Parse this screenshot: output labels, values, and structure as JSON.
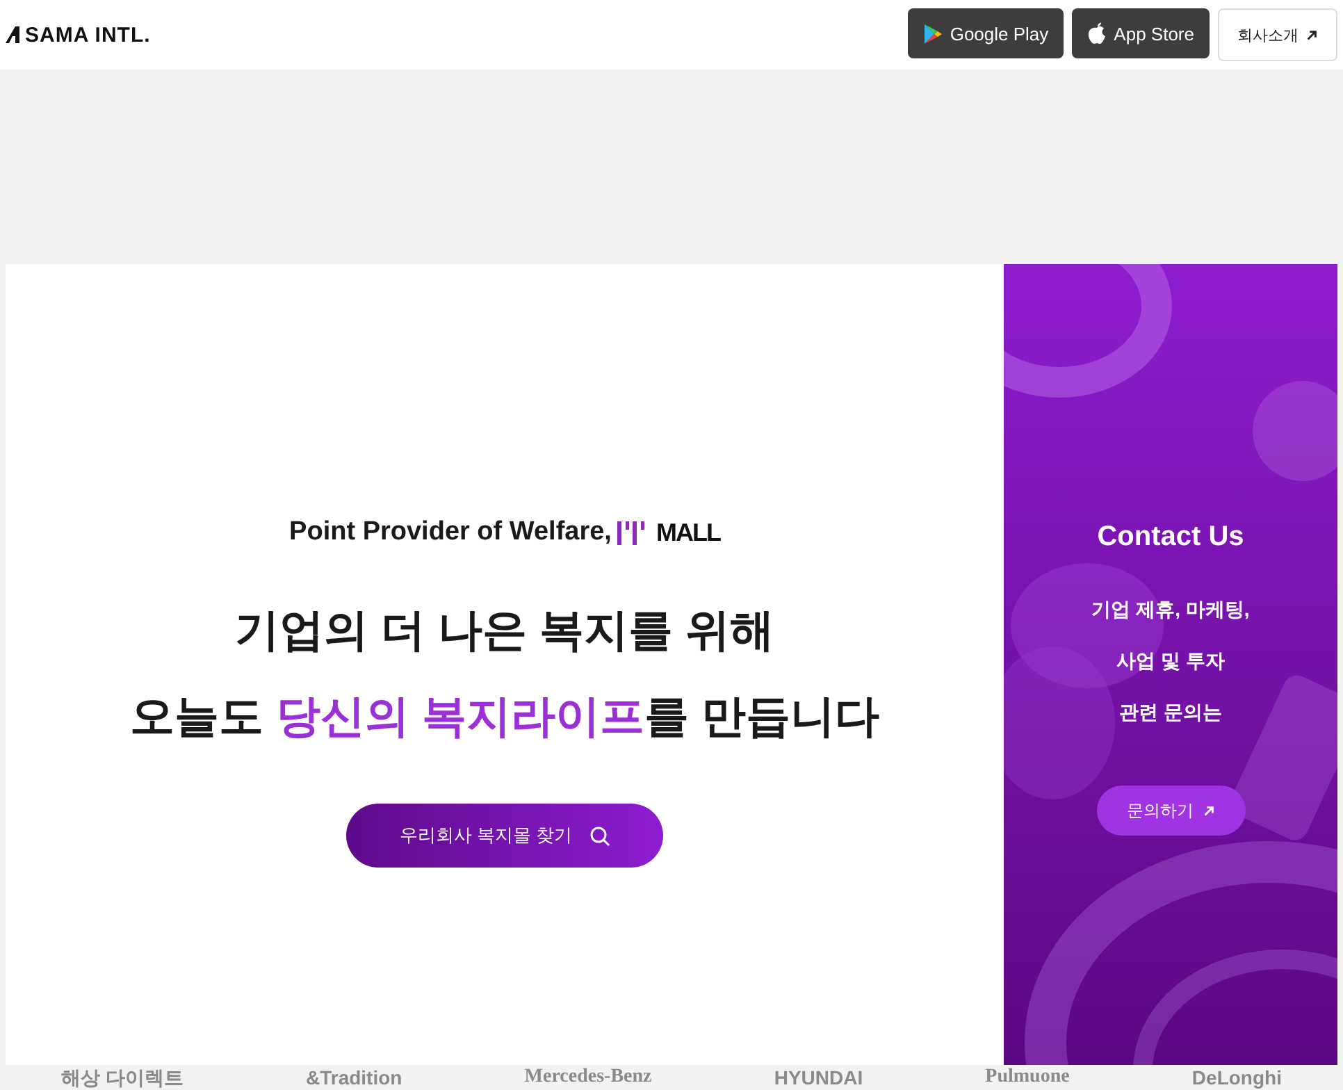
{
  "header": {
    "logo": "SAMA INTL.",
    "buttons": [
      {
        "kind": "google",
        "label": "Google Play"
      },
      {
        "kind": "apple",
        "label": "App Store"
      },
      {
        "kind": "link",
        "label": "회사소개"
      }
    ]
  },
  "hero": {
    "tagline": "Point Provider of Welfare,",
    "brand": "MALL",
    "headline_1": "기업의 더 나은 복지를 위해",
    "headline_2_before": "오늘도 ",
    "headline_2_highlight": "당신의 복지라이프",
    "headline_2_after": "를 만듭니다",
    "button": "우리회사 복지몰 찾기"
  },
  "contact": {
    "title": "Contact Us",
    "lines": [
      "기업 제휴, 마케팅,",
      "사업 및 투자",
      "관련 문의는"
    ],
    "button": "문의하기"
  },
  "partners": [
    "해상 다이렉트",
    "&Tradition",
    "Mercedes-Benz",
    "HYUNDAI",
    "Pulmuone",
    "DeLonghi"
  ]
}
